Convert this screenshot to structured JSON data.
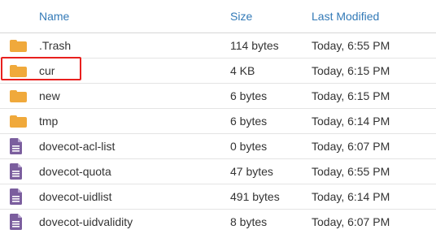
{
  "header": {
    "name_label": "Name",
    "size_label": "Size",
    "modified_label": "Last Modified"
  },
  "files": [
    {
      "name": ".Trash",
      "size": "114 bytes",
      "modified": "Today, 6:55 PM",
      "type": "folder"
    },
    {
      "name": "cur",
      "size": "4 KB",
      "modified": "Today, 6:15 PM",
      "type": "folder",
      "highlighted": true
    },
    {
      "name": "new",
      "size": "6 bytes",
      "modified": "Today, 6:15 PM",
      "type": "folder"
    },
    {
      "name": "tmp",
      "size": "6 bytes",
      "modified": "Today, 6:14 PM",
      "type": "folder"
    },
    {
      "name": "dovecot-acl-list",
      "size": "0 bytes",
      "modified": "Today, 6:07 PM",
      "type": "file"
    },
    {
      "name": "dovecot-quota",
      "size": "47 bytes",
      "modified": "Today, 6:55 PM",
      "type": "file"
    },
    {
      "name": "dovecot-uidlist",
      "size": "491 bytes",
      "modified": "Today, 6:14 PM",
      "type": "file"
    },
    {
      "name": "dovecot-uidvalidity",
      "size": "8 bytes",
      "modified": "Today, 6:07 PM",
      "type": "file"
    }
  ],
  "icons": {
    "folder": "folder-icon",
    "file": "file-icon"
  },
  "colors": {
    "header_link": "#337ab7",
    "folder": "#f0a93b",
    "file": "#7b5e9e",
    "highlight": "#e8201e"
  }
}
